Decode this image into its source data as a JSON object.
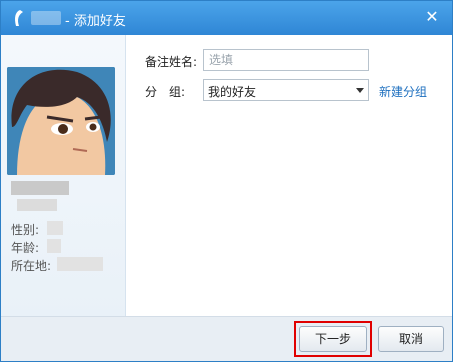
{
  "window": {
    "title": "- 添加好友",
    "close_glyph": "✕",
    "app_icon": "qq-icon"
  },
  "profile": {
    "gender_label": "性别:",
    "age_label": "年龄:",
    "location_label": "所在地:"
  },
  "form": {
    "remark_label": "备注姓名:",
    "remark_placeholder": "选填",
    "group_label": "分　组:",
    "group_selected": "我的好友",
    "new_group_link": "新建分组"
  },
  "buttons": {
    "next": "下一步",
    "cancel": "取消"
  },
  "colors": {
    "titlebar": "#3d94de",
    "link": "#1d6fbf",
    "highlight": "#e00000"
  }
}
